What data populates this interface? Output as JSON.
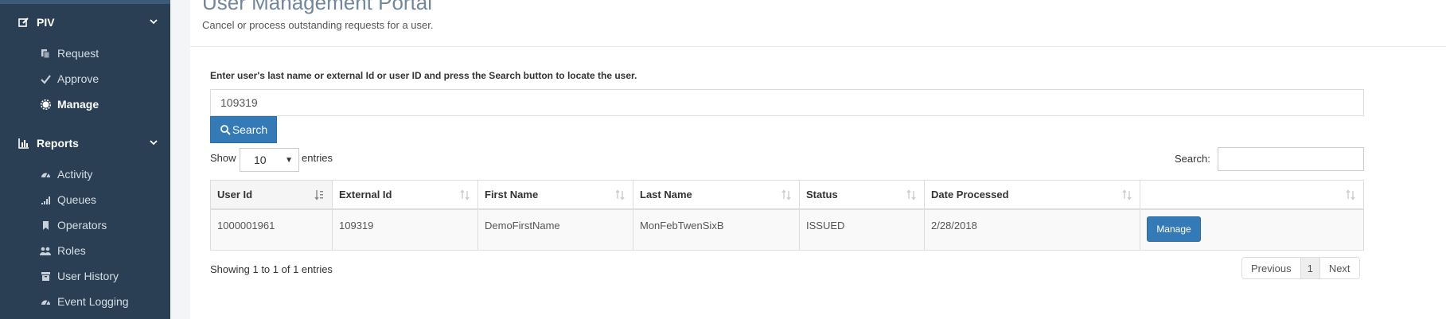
{
  "sidebar": {
    "sections": [
      {
        "label": "PIV",
        "icon": "edit-icon",
        "items": [
          {
            "label": "Request",
            "icon": "copy-icon"
          },
          {
            "label": "Approve",
            "icon": "check-icon"
          },
          {
            "label": "Manage",
            "icon": "cog-icon",
            "active": true
          }
        ]
      },
      {
        "label": "Reports",
        "icon": "bar-chart-icon",
        "items": [
          {
            "label": "Activity",
            "icon": "dashboard-icon"
          },
          {
            "label": "Queues",
            "icon": "signal-icon"
          },
          {
            "label": "Operators",
            "icon": "bookmark-icon"
          },
          {
            "label": "Roles",
            "icon": "users-icon"
          },
          {
            "label": "User History",
            "icon": "archive-icon"
          },
          {
            "label": "Event Logging",
            "icon": "dashboard-icon"
          }
        ]
      }
    ]
  },
  "header": {
    "title": "User Management Portal",
    "subtitle": "Cancel or process outstanding requests for a user."
  },
  "search": {
    "instruction": "Enter user's last name or external Id or user ID and press the Search button to locate the user.",
    "value": "109319",
    "button_label": "Search"
  },
  "table_controls": {
    "show_label": "Show",
    "page_length": "10",
    "entries_label": "entries",
    "filter_label": "Search:",
    "filter_value": ""
  },
  "table": {
    "columns": [
      "User Id",
      "External Id",
      "First Name",
      "Last Name",
      "Status",
      "Date Processed",
      ""
    ],
    "rows": [
      {
        "user_id": "1000001961",
        "external_id": "109319",
        "first_name": "DemoFirstName",
        "last_name": "MonFebTwenSixB",
        "status": "ISSUED",
        "date_processed": "2/28/2018",
        "action_label": "Manage"
      }
    ]
  },
  "footer": {
    "info": "Showing 1 to 1 of 1 entries",
    "pagination": {
      "previous": "Previous",
      "current": "1",
      "next": "Next"
    }
  },
  "colors": {
    "sidebar_bg": "#2a3f54",
    "primary": "#337ab7",
    "title": "#73879c"
  }
}
